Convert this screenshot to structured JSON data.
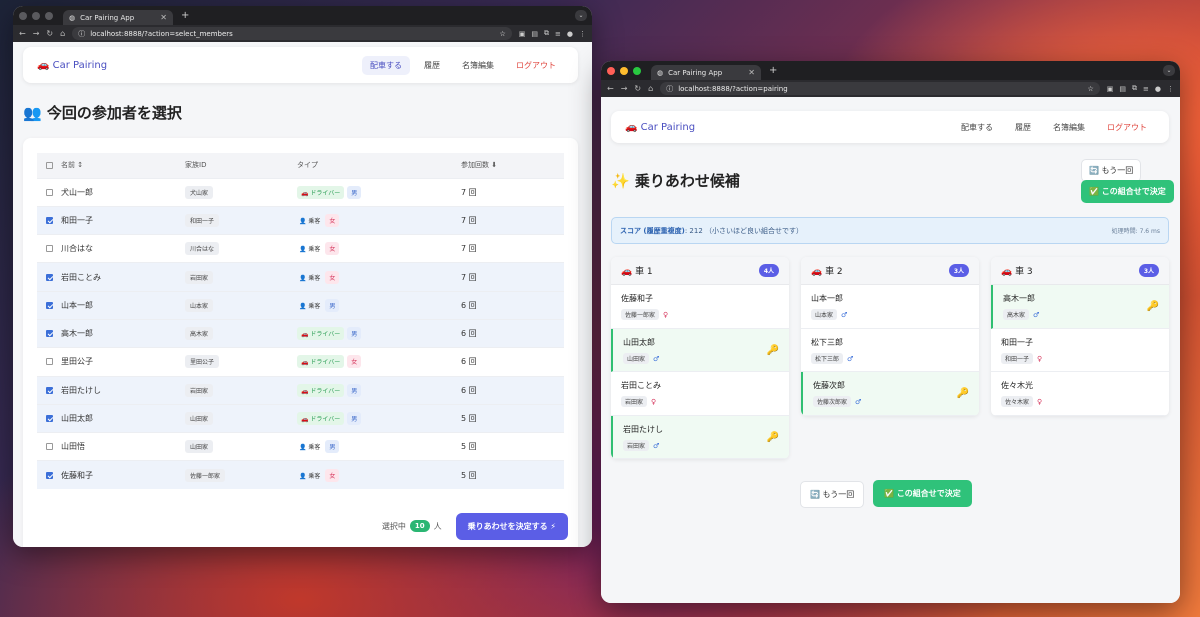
{
  "left": {
    "tab_title": "Car Pairing App",
    "url": "localhost:8888/?action=select_members",
    "brand": "🚗 Car Pairing",
    "nav": {
      "assign": "配車する",
      "history": "履歴",
      "roster": "名簿編集",
      "logout": "ログアウト"
    },
    "page_title": "👥 今回の参加者を選択",
    "headers": {
      "name": "名前 ↕",
      "family": "家族ID",
      "type": "タイプ",
      "count": "参加回数 ⬇"
    },
    "rows": [
      {
        "checked": false,
        "name": "犬山一郎",
        "family": "犬山家",
        "type": "🚗 ドライバー",
        "driver": true,
        "gender": "男",
        "male": true,
        "count": "7 回"
      },
      {
        "checked": true,
        "name": "和田一子",
        "family": "和田一子",
        "type": "👤 乗客",
        "driver": false,
        "gender": "女",
        "male": false,
        "count": "7 回"
      },
      {
        "checked": false,
        "name": "川合はな",
        "family": "川合はな",
        "type": "👤 乗客",
        "driver": false,
        "gender": "女",
        "male": false,
        "count": "7 回"
      },
      {
        "checked": true,
        "name": "岩田ことみ",
        "family": "岩田家",
        "type": "👤 乗客",
        "driver": false,
        "gender": "女",
        "male": false,
        "count": "7 回"
      },
      {
        "checked": true,
        "name": "山本一郎",
        "family": "山本家",
        "type": "👤 乗客",
        "driver": false,
        "gender": "男",
        "male": true,
        "count": "6 回"
      },
      {
        "checked": true,
        "name": "高木一郎",
        "family": "高木家",
        "type": "🚗 ドライバー",
        "driver": true,
        "gender": "男",
        "male": true,
        "count": "6 回"
      },
      {
        "checked": false,
        "name": "里田公子",
        "family": "里田公子",
        "type": "🚗 ドライバー",
        "driver": true,
        "gender": "女",
        "male": false,
        "count": "6 回"
      },
      {
        "checked": true,
        "name": "岩田たけし",
        "family": "岩田家",
        "type": "🚗 ドライバー",
        "driver": true,
        "gender": "男",
        "male": true,
        "count": "6 回"
      },
      {
        "checked": true,
        "name": "山田太郎",
        "family": "山田家",
        "type": "🚗 ドライバー",
        "driver": true,
        "gender": "男",
        "male": true,
        "count": "5 回"
      },
      {
        "checked": false,
        "name": "山田悟",
        "family": "山田家",
        "type": "👤 乗客",
        "driver": false,
        "gender": "男",
        "male": true,
        "count": "5 回"
      },
      {
        "checked": true,
        "name": "佐藤和子",
        "family": "佐藤一郎家",
        "type": "👤 乗客",
        "driver": false,
        "gender": "女",
        "male": false,
        "count": "5 回"
      }
    ],
    "footer": {
      "selected_prefix": "選択中",
      "selected_count": "10",
      "selected_suffix": "人",
      "submit": "乗りあわせを決定する ⚡"
    }
  },
  "right": {
    "tab_title": "Car Pairing App",
    "url": "localhost:8888/?action=pairing",
    "brand": "🚗 Car Pairing",
    "nav": {
      "assign": "配車する",
      "history": "履歴",
      "roster": "名簿編集",
      "logout": "ログアウト"
    },
    "page_title": "✨ 乗りあわせ候補",
    "again": "🔄 もう一回",
    "decide": "✅ この組合せで決定",
    "score_label": "スコア (履歴重複度)",
    "score_text": ": 212 （小さいほど良い組合せです）",
    "time": "処理時間: 7.6 ms",
    "cars": [
      {
        "title": "🚗 車 1",
        "count": "4人",
        "members": [
          {
            "name": "佐藤和子",
            "family": "佐藤一郎家",
            "g": "♀",
            "male": false,
            "driver": false
          },
          {
            "name": "山田太郎",
            "family": "山田家",
            "g": "♂",
            "male": true,
            "driver": true
          },
          {
            "name": "岩田ことみ",
            "family": "岩田家",
            "g": "♀",
            "male": false,
            "driver": false
          },
          {
            "name": "岩田たけし",
            "family": "岩田家",
            "g": "♂",
            "male": true,
            "driver": true
          }
        ]
      },
      {
        "title": "🚗 車 2",
        "count": "3人",
        "members": [
          {
            "name": "山本一郎",
            "family": "山本家",
            "g": "♂",
            "male": true,
            "driver": false
          },
          {
            "name": "松下三郎",
            "family": "松下三郎",
            "g": "♂",
            "male": true,
            "driver": false
          },
          {
            "name": "佐藤次郎",
            "family": "佐藤次郎家",
            "g": "♂",
            "male": true,
            "driver": true
          }
        ]
      },
      {
        "title": "🚗 車 3",
        "count": "3人",
        "members": [
          {
            "name": "高木一郎",
            "family": "高木家",
            "g": "♂",
            "male": true,
            "driver": true
          },
          {
            "name": "和田一子",
            "family": "和田一子",
            "g": "♀",
            "male": false,
            "driver": false
          },
          {
            "name": "佐々木光",
            "family": "佐々木家",
            "g": "♀",
            "male": false,
            "driver": false
          }
        ]
      }
    ],
    "key_icon": "🔑"
  }
}
